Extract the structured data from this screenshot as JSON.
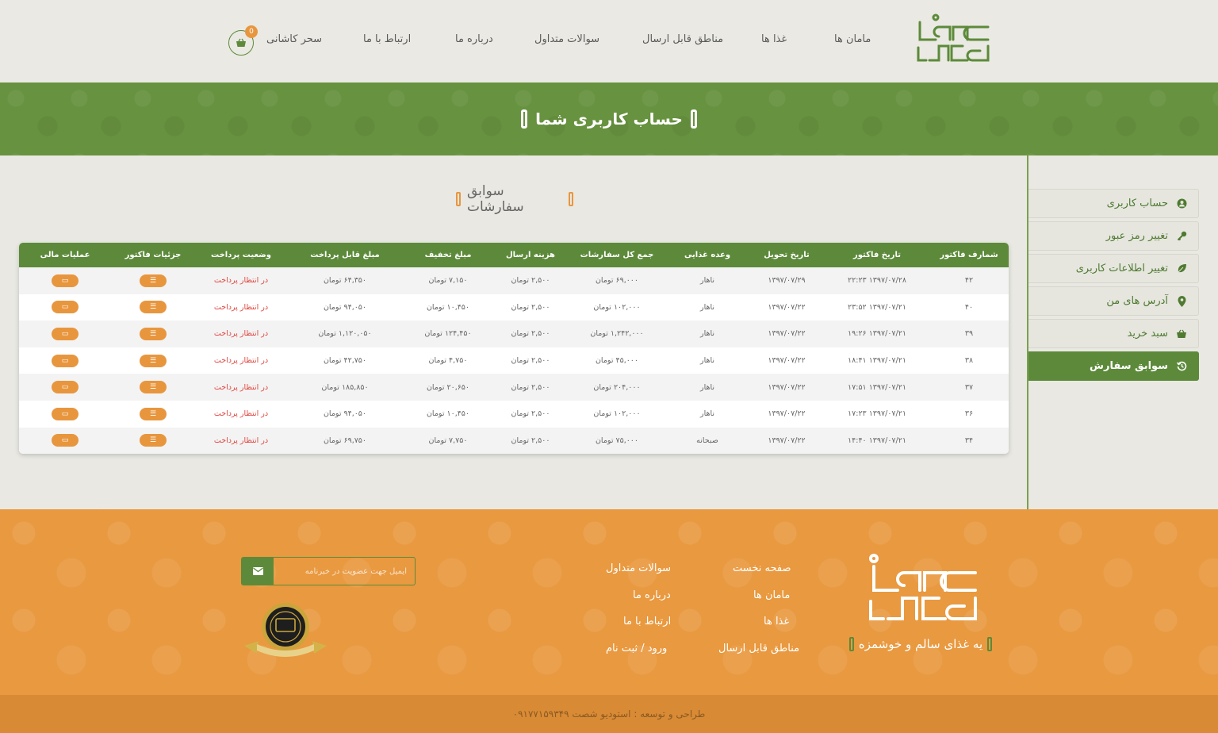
{
  "header": {
    "nav": [
      {
        "label": "مامان ها"
      },
      {
        "label": "غذا ها"
      },
      {
        "label": "مناطق قابل ارسال"
      },
      {
        "label": "سوالات متداول"
      },
      {
        "label": "درباره ما"
      },
      {
        "label": "ارتباط با ما"
      }
    ],
    "user_name": "سحر کاشانی",
    "cart_count": "0"
  },
  "banner": {
    "title": "حساب کاربری شما"
  },
  "section": {
    "title": "سوابق سفارشات"
  },
  "sidebar": {
    "items": [
      {
        "label": "حساب کاربری",
        "icon": "user-circle-icon"
      },
      {
        "label": "تغییر رمز عبور",
        "icon": "key-icon"
      },
      {
        "label": "تغییر اطلاعات کاربری",
        "icon": "leaf-icon"
      },
      {
        "label": "آدرس های من",
        "icon": "map-pin-icon"
      },
      {
        "label": "سبد خرید",
        "icon": "basket-icon"
      },
      {
        "label": "سوابق سفارش",
        "icon": "history-icon",
        "active": true
      }
    ]
  },
  "table": {
    "headers": [
      "شمارف فاکتور",
      "تاریخ فاکتور",
      "تاریخ تحویل",
      "وعده غذایی",
      "جمع کل سفارشات",
      "هزینه ارسال",
      "مبلغ تخفیف",
      "مبلغ قابل پرداخت",
      "وضعیت پرداخت",
      "جزئیات فاکتور",
      "عملیات مالی"
    ],
    "rows": [
      [
        "۴۲",
        "۱۳۹۷/۰۷/۲۸ ۲۲:۲۳",
        "۱۳۹۷/۰۷/۲۹",
        "ناهار",
        "۶۹,۰۰۰ تومان",
        "۲,۵۰۰ تومان",
        "۷,۱۵۰ تومان",
        "۶۴,۳۵۰ تومان",
        "در انتظار پرداخت"
      ],
      [
        "۴۰",
        "۱۳۹۷/۰۷/۲۱ ۲۳:۵۲",
        "۱۳۹۷/۰۷/۲۲",
        "ناهار",
        "۱۰۲,۰۰۰ تومان",
        "۲,۵۰۰ تومان",
        "۱۰,۴۵۰ تومان",
        "۹۴,۰۵۰ تومان",
        "در انتظار پرداخت"
      ],
      [
        "۳۹",
        "۱۳۹۷/۰۷/۲۱ ۱۹:۲۶",
        "۱۳۹۷/۰۷/۲۲",
        "ناهار",
        "۱,۲۴۲,۰۰۰ تومان",
        "۲,۵۰۰ تومان",
        "۱۲۴,۴۵۰ تومان",
        "۱,۱۲۰,۰۵۰ تومان",
        "در انتظار پرداخت"
      ],
      [
        "۳۸",
        "۱۳۹۷/۰۷/۲۱ ۱۸:۴۱",
        "۱۳۹۷/۰۷/۲۲",
        "ناهار",
        "۴۵,۰۰۰ تومان",
        "۲,۵۰۰ تومان",
        "۴,۷۵۰ تومان",
        "۴۲,۷۵۰ تومان",
        "در انتظار پرداخت"
      ],
      [
        "۳۷",
        "۱۳۹۷/۰۷/۲۱ ۱۷:۵۱",
        "۱۳۹۷/۰۷/۲۲",
        "ناهار",
        "۲۰۴,۰۰۰ تومان",
        "۲,۵۰۰ تومان",
        "۲۰,۶۵۰ تومان",
        "۱۸۵,۸۵۰ تومان",
        "در انتظار پرداخت"
      ],
      [
        "۳۶",
        "۱۳۹۷/۰۷/۲۱ ۱۷:۲۳",
        "۱۳۹۷/۰۷/۲۲",
        "ناهار",
        "۱۰۲,۰۰۰ تومان",
        "۲,۵۰۰ تومان",
        "۱۰,۴۵۰ تومان",
        "۹۴,۰۵۰ تومان",
        "در انتظار پرداخت"
      ],
      [
        "۳۴",
        "۱۳۹۷/۰۷/۲۱ ۱۴:۴۰",
        "۱۳۹۷/۰۷/۲۲",
        "صبحانه",
        "۷۵,۰۰۰ تومان",
        "۲,۵۰۰ تومان",
        "۷,۷۵۰ تومان",
        "۶۹,۷۵۰ تومان",
        "در انتظار پرداخت"
      ]
    ]
  },
  "footer": {
    "slogan": "یه غذای سالم و خوشمزه",
    "links_col1": [
      "صفحه نخست",
      "مامان ها",
      "غذا ها",
      "مناطق قابل ارسال"
    ],
    "links_col2": [
      "سوالات متداول",
      "درباره ما",
      "ارتباط با ما",
      "ورود / ثبت نام"
    ],
    "newsletter_placeholder": "ایمیل جهت عضویت در خبرنامه",
    "copyright": "طراحی و توسعه : استودیو شصت ۰۹۱۷۷۱۵۹۳۴۹"
  },
  "colors": {
    "green": "#5c8a3a",
    "orange": "#e8963e",
    "status_red": "#e0443e"
  }
}
